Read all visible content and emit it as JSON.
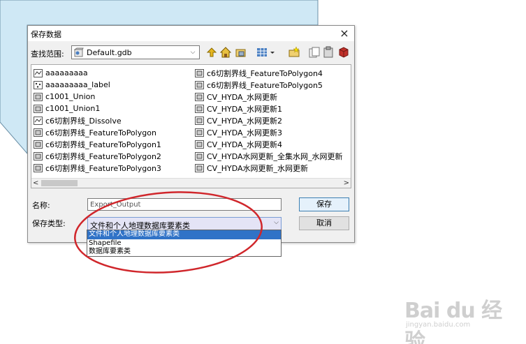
{
  "dialog": {
    "title": "保存数据",
    "close_symbol": "×"
  },
  "lookin": {
    "label": "查找范围:",
    "value": "Default.gdb"
  },
  "toolbar": {
    "icons": [
      "up-one-level-icon",
      "home-icon",
      "connect-folder-icon",
      "view-grid-icon",
      "view-dropdown-icon",
      "new-folder-icon",
      "copy-icon",
      "paste-icon",
      "delete-icon"
    ]
  },
  "files": {
    "col1": [
      {
        "name": "aaaaaaaaa",
        "icon": "line-feature-icon"
      },
      {
        "name": "aaaaaaaaa_label",
        "icon": "point-feature-icon"
      },
      {
        "name": "c1001_Union",
        "icon": "polygon-feature-icon"
      },
      {
        "name": "c1001_Union1",
        "icon": "polygon-feature-icon"
      },
      {
        "name": "c6切割界线_Dissolve",
        "icon": "line-feature-icon"
      },
      {
        "name": "c6切割界线_FeatureToPolygon",
        "icon": "polygon-feature-icon"
      },
      {
        "name": "c6切割界线_FeatureToPolygon1",
        "icon": "polygon-feature-icon"
      },
      {
        "name": "c6切割界线_FeatureToPolygon2",
        "icon": "polygon-feature-icon"
      },
      {
        "name": "c6切割界线_FeatureToPolygon3",
        "icon": "polygon-feature-icon"
      }
    ],
    "col2": [
      {
        "name": "c6切割界线_FeatureToPolygon4",
        "icon": "polygon-feature-icon"
      },
      {
        "name": "c6切割界线_FeatureToPolygon5",
        "icon": "polygon-feature-icon"
      },
      {
        "name": "CV_HYDA_水网更新",
        "icon": "polygon-feature-icon"
      },
      {
        "name": "CV_HYDA_水网更新1",
        "icon": "polygon-feature-icon"
      },
      {
        "name": "CV_HYDA_水网更新2",
        "icon": "polygon-feature-icon"
      },
      {
        "name": "CV_HYDA_水网更新3",
        "icon": "polygon-feature-icon"
      },
      {
        "name": "CV_HYDA_水网更新4",
        "icon": "polygon-feature-icon"
      },
      {
        "name": "CV_HYDA水网更新_全集水网_水网更新",
        "icon": "polygon-feature-icon"
      },
      {
        "name": "CV_HYDA水网更新_水网更新",
        "icon": "polygon-feature-icon"
      }
    ]
  },
  "scroll": {
    "left_arrow": "<",
    "right_arrow": ">"
  },
  "form": {
    "name_label": "名称:",
    "name_value": "Export_Output",
    "type_label": "保存类型:",
    "type_value": "文件和个人地理数据库要素类",
    "save_label": "保存",
    "cancel_label": "取消"
  },
  "dropdown": {
    "options": [
      "文件和个人地理数据库要素类",
      "Shapefile",
      "数据库要素类"
    ],
    "selected_index": 0
  },
  "watermark": {
    "text": "Bai du 经验",
    "url": "jingyan.baidu.com"
  },
  "colors": {
    "background_shape": "#cfe8f5",
    "highlight": "#3073c7",
    "annotation": "#d0262b"
  }
}
